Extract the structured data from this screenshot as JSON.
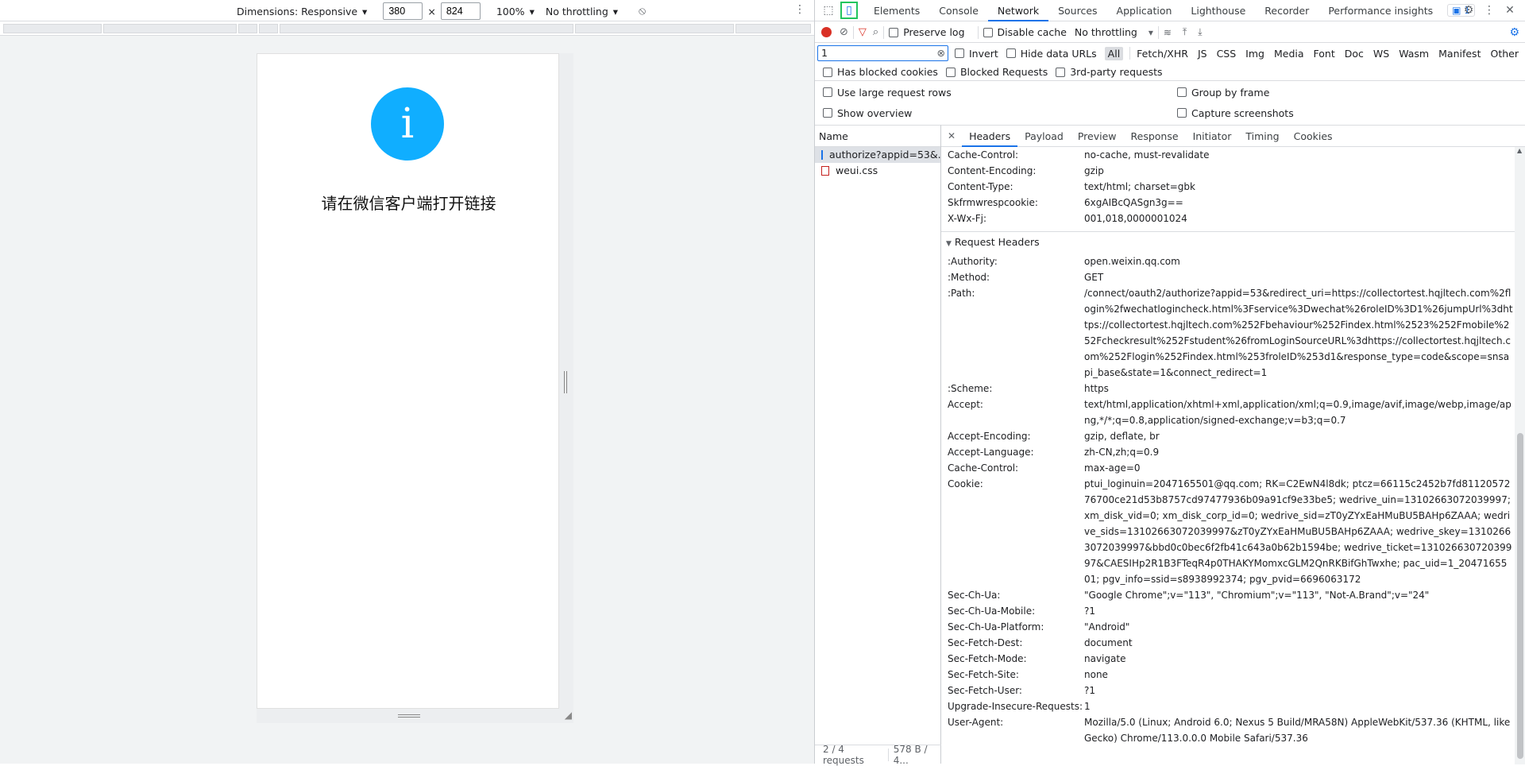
{
  "device_toolbar": {
    "dimensions_label": "Dimensions: Responsive",
    "width": "380",
    "times": "×",
    "height": "824",
    "zoom": "100%",
    "throttling": "No throttling"
  },
  "page": {
    "info_glyph": "i",
    "message": "请在微信客户端打开链接"
  },
  "devtools": {
    "tabs": [
      "Elements",
      "Console",
      "Network",
      "Sources",
      "Application",
      "Lighthouse",
      "Recorder",
      "Performance insights"
    ],
    "active_tab": "Network",
    "issues_count": "1",
    "toolbar": {
      "throttling": "No throttling",
      "preserve_log": "Preserve log",
      "disable_cache": "Disable cache"
    },
    "filter": {
      "value": "1",
      "invert": "Invert",
      "hide_data_urls": "Hide data URLs"
    },
    "types": [
      "All",
      "Fetch/XHR",
      "JS",
      "CSS",
      "Img",
      "Media",
      "Font",
      "Doc",
      "WS",
      "Wasm",
      "Manifest",
      "Other"
    ],
    "row3": {
      "blocked_cookies": "Has blocked cookies",
      "blocked_requests": "Blocked Requests",
      "third_party": "3rd-party requests"
    },
    "settings": {
      "large_rows": "Use large request rows",
      "group_frame": "Group by frame",
      "show_overview": "Show overview",
      "capture": "Capture screenshots"
    },
    "name_header": "Name",
    "requests": [
      "authorize?appid=53&...",
      "weui.css"
    ],
    "status": {
      "requests": "2 / 4 requests",
      "size": "578 B / 4..."
    },
    "detail_tabs": [
      "Headers",
      "Payload",
      "Preview",
      "Response",
      "Initiator",
      "Timing",
      "Cookies"
    ],
    "response_headers": [
      {
        "name": "Cache-Control:",
        "value": "no-cache, must-revalidate"
      },
      {
        "name": "Content-Encoding:",
        "value": "gzip"
      },
      {
        "name": "Content-Type:",
        "value": "text/html; charset=gbk"
      },
      {
        "name": "Skfrmwrespcookie:",
        "value": "6xgAIBcQASgn3g=="
      },
      {
        "name": "X-Wx-Fj:",
        "value": "001,018,0000001024"
      }
    ],
    "request_section": "Request Headers",
    "request_headers": [
      {
        "name": ":Authority:",
        "value": "open.weixin.qq.com"
      },
      {
        "name": ":Method:",
        "value": "GET"
      },
      {
        "name": ":Path:",
        "value": "/connect/oauth2/authorize?appid=53&redirect_uri=https://collectortest.hqjltech.com%2flogin%2fwechatlogincheck.html%3Fservice%3Dwechat%26roleID%3D1%26jumpUrl%3dhttps://collectortest.hqjltech.com%252Fbehaviour%252Findex.html%2523%252Fmobile%252Fcheckresult%252Fstudent%26fromLoginSourceURL%3dhttps://collectortest.hqjltech.com%252Flogin%252Findex.html%253froleID%253d1&response_type=code&scope=snsapi_base&state=1&connect_redirect=1"
      },
      {
        "name": ":Scheme:",
        "value": "https"
      },
      {
        "name": "Accept:",
        "value": "text/html,application/xhtml+xml,application/xml;q=0.9,image/avif,image/webp,image/apng,*/*;q=0.8,application/signed-exchange;v=b3;q=0.7"
      },
      {
        "name": "Accept-Encoding:",
        "value": "gzip, deflate, br"
      },
      {
        "name": "Accept-Language:",
        "value": "zh-CN,zh;q=0.9"
      },
      {
        "name": "Cache-Control:",
        "value": "max-age=0"
      },
      {
        "name": "Cookie:",
        "value": "ptui_loginuin=2047165501@qq.com; RK=C2EwN4l8dk; ptcz=66115c2452b7fd8112057276700ce21d53b8757cd97477936b09a91cf9e33be5; wedrive_uin=13102663072039997; xm_disk_vid=0; xm_disk_corp_id=0; wedrive_sid=zT0yZYxEaHMuBU5BAHp6ZAAA; wedrive_sids=13102663072039997&zT0yZYxEaHMuBU5BAHp6ZAAA; wedrive_skey=13102663072039997&bbd0c0bec6f2fb41c643a0b62b1594be; wedrive_ticket=13102663072039997&CAESIHp2R1B3FTeqR4p0THAKYMomxcGLM2QnRKBifGhTwxhe; pac_uid=1_2047165501; pgv_info=ssid=s8938992374; pgv_pvid=6696063172"
      },
      {
        "name": "Sec-Ch-Ua:",
        "value": "\"Google Chrome\";v=\"113\", \"Chromium\";v=\"113\", \"Not-A.Brand\";v=\"24\""
      },
      {
        "name": "Sec-Ch-Ua-Mobile:",
        "value": "?1"
      },
      {
        "name": "Sec-Ch-Ua-Platform:",
        "value": "\"Android\""
      },
      {
        "name": "Sec-Fetch-Dest:",
        "value": "document"
      },
      {
        "name": "Sec-Fetch-Mode:",
        "value": "navigate"
      },
      {
        "name": "Sec-Fetch-Site:",
        "value": "none"
      },
      {
        "name": "Sec-Fetch-User:",
        "value": "?1"
      },
      {
        "name": "Upgrade-Insecure-Requests:",
        "value": "1"
      },
      {
        "name": "User-Agent:",
        "value": "Mozilla/5.0 (Linux; Android 6.0; Nexus 5 Build/MRA58N) AppleWebKit/537.36 (KHTML, like Gecko) Chrome/113.0.0.0 Mobile Safari/537.36"
      }
    ]
  }
}
